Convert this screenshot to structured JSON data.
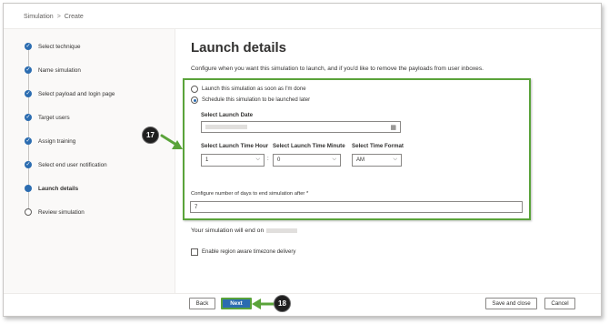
{
  "breadcrumb": {
    "root": "Simulation",
    "separator": ">",
    "current": "Create"
  },
  "steps": [
    {
      "label": "Select technique",
      "state": "done"
    },
    {
      "label": "Name simulation",
      "state": "done"
    },
    {
      "label": "Select payload and login page",
      "state": "done"
    },
    {
      "label": "Target users",
      "state": "done"
    },
    {
      "label": "Assign training",
      "state": "done"
    },
    {
      "label": "Select end user notification",
      "state": "done"
    },
    {
      "label": "Launch details",
      "state": "current"
    },
    {
      "label": "Review simulation",
      "state": "pending"
    }
  ],
  "main": {
    "title": "Launch details",
    "subtitle": "Configure when you want this simulation to launch, and if you'd like to remove the payloads from user inboxes.",
    "radio_launch_now": "Launch this simulation as soon as I'm done",
    "radio_schedule": "Schedule this simulation to be launched later",
    "selected_radio": "schedule",
    "launch_date_label": "Select Launch Date",
    "hour_label": "Select Launch Time Hour",
    "minute_label": "Select Launch Time Minute",
    "format_label": "Select Time Format",
    "hour_value": "1",
    "time_colon": ":",
    "minute_value": "0",
    "format_value": "AM",
    "days_label": "Configure number of days to end simulation after *",
    "days_value": "7",
    "end_on_text": "Your simulation will end on",
    "timezone_checkbox_label": "Enable region aware timezone delivery",
    "timezone_checked": false
  },
  "footer": {
    "back": "Back",
    "next": "Next",
    "save_close": "Save and close",
    "cancel": "Cancel"
  },
  "annotations": {
    "badge_17": "17",
    "badge_18": "18"
  },
  "icons": {
    "calendar": "calendar-icon",
    "chevron": "chevron-down-icon",
    "check": "checkmark-icon"
  },
  "colors": {
    "accent": "#2b6cb0",
    "highlight": "#5aa33a",
    "badge": "#1f1f1f"
  }
}
